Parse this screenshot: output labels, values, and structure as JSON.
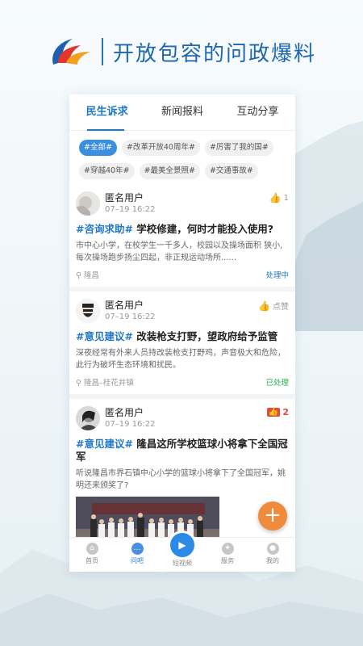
{
  "header": {
    "slogan": "开放包容的问政爆料",
    "logo_icon": "brand-swoosh-icon"
  },
  "tabs": [
    {
      "label": "民生诉求",
      "active": true
    },
    {
      "label": "新闻报料"
    },
    {
      "label": "互动分享"
    }
  ],
  "tags": [
    "#全部#",
    "#改革开放40周年#",
    "#厉害了我的国#",
    "#穿越40年#",
    "#最美全景照#",
    "#交通事故#"
  ],
  "posts": [
    {
      "user": "匿名用户",
      "time": "07–19 16:22",
      "likes": "1",
      "topic": "#咨询求助#",
      "title": " 学校修建，何时才能投入使用?",
      "body": "市中心小学，在校学生一千多人，校园以及操场面积 狭小, 每次操场跑步扬尘四起，非正规运动场所......",
      "location": "隆昌",
      "status": "处理中"
    },
    {
      "user": "匿名用户",
      "time": "07–19 16:22",
      "likes": "点赞",
      "topic": "#意见建议#",
      "title": " 改装枪支打野，望政府给予监管",
      "body": "深夜经常有外来人员持改装枪支打野鸡，声音极大和危险，此行为破坏生态环境和扰民。",
      "location": "隆昌–桂花井镇",
      "status": "已处理"
    },
    {
      "user": "匿名用户",
      "time": "07–19 16:22",
      "likes": "2",
      "topic": "#意见建议#",
      "title": " 隆昌这所学校篮球小将拿下全国冠军",
      "body": "听说隆昌市界石镇中心小学的篮球小将拿下了全国冠军，姚明还来颁奖了?"
    }
  ],
  "nav": [
    {
      "label": "首页",
      "icon": "home-icon"
    },
    {
      "label": "问吧",
      "icon": "chat-icon",
      "active": true
    },
    {
      "label": "短视频",
      "icon": "play-icon"
    },
    {
      "label": "服务",
      "icon": "compass-icon"
    },
    {
      "label": "我的",
      "icon": "user-icon"
    }
  ],
  "fab": {
    "label": "+",
    "icon": "add-icon"
  },
  "colors": {
    "accent": "#1f78c8",
    "done": "#27b35a",
    "fab": "#f08b3c",
    "like_active": "#e24a3b"
  }
}
